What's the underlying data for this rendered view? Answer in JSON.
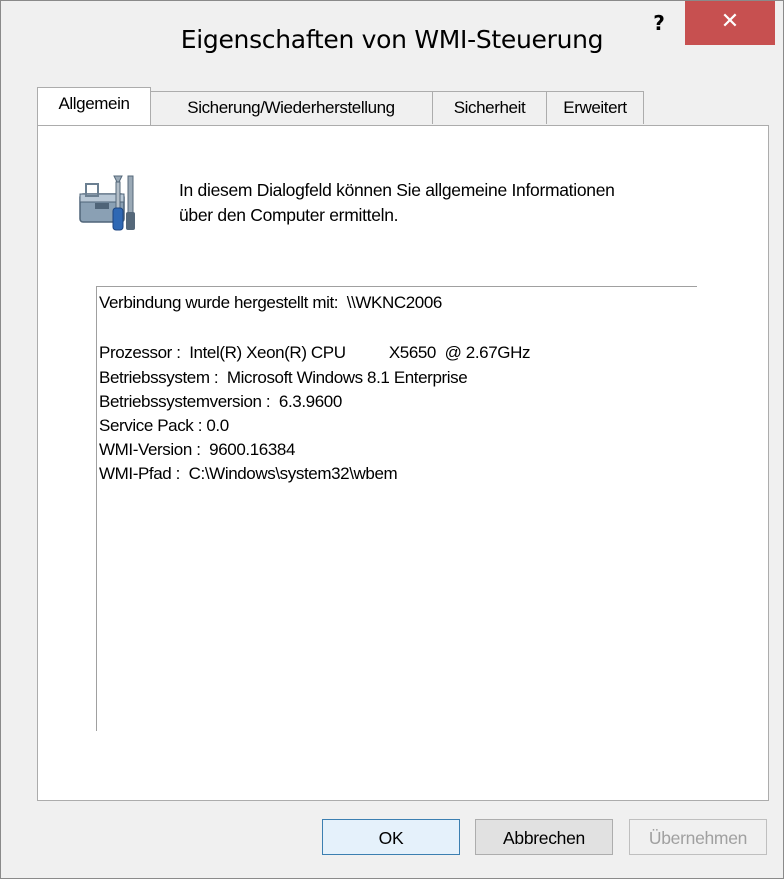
{
  "window": {
    "title": "Eigenschaften von WMI-Steuerung",
    "help_label": "?",
    "close_label": "✕"
  },
  "tabs": [
    {
      "label": "Allgemein",
      "active": true
    },
    {
      "label": "Sicherung/Wiederherstellung",
      "active": false
    },
    {
      "label": "Sicherheit",
      "active": false
    },
    {
      "label": "Erweitert",
      "active": false
    }
  ],
  "general": {
    "icon": "wmi-tools-icon",
    "description_line1": "In diesem Dialogfeld können Sie allgemeine Informationen",
    "description_line2": "über den Computer ermitteln.",
    "connection": "Verbindung wurde hergestellt mit:  \\\\WKNC2006",
    "processor": "Prozessor :  Intel(R) Xeon(R) CPU          X5650  @ 2.67GHz",
    "os": "Betriebssystem :  Microsoft Windows 8.1 Enterprise",
    "os_version": "Betriebssystemversion :  6.3.9600",
    "service_pack": "Service Pack : 0.0",
    "wmi_version": "WMI-Version :  9600.16384",
    "wmi_path": "WMI-Pfad :  C:\\Windows\\system32\\wbem"
  },
  "buttons": {
    "ok": "OK",
    "cancel": "Abbrechen",
    "apply": "Übernehmen"
  }
}
